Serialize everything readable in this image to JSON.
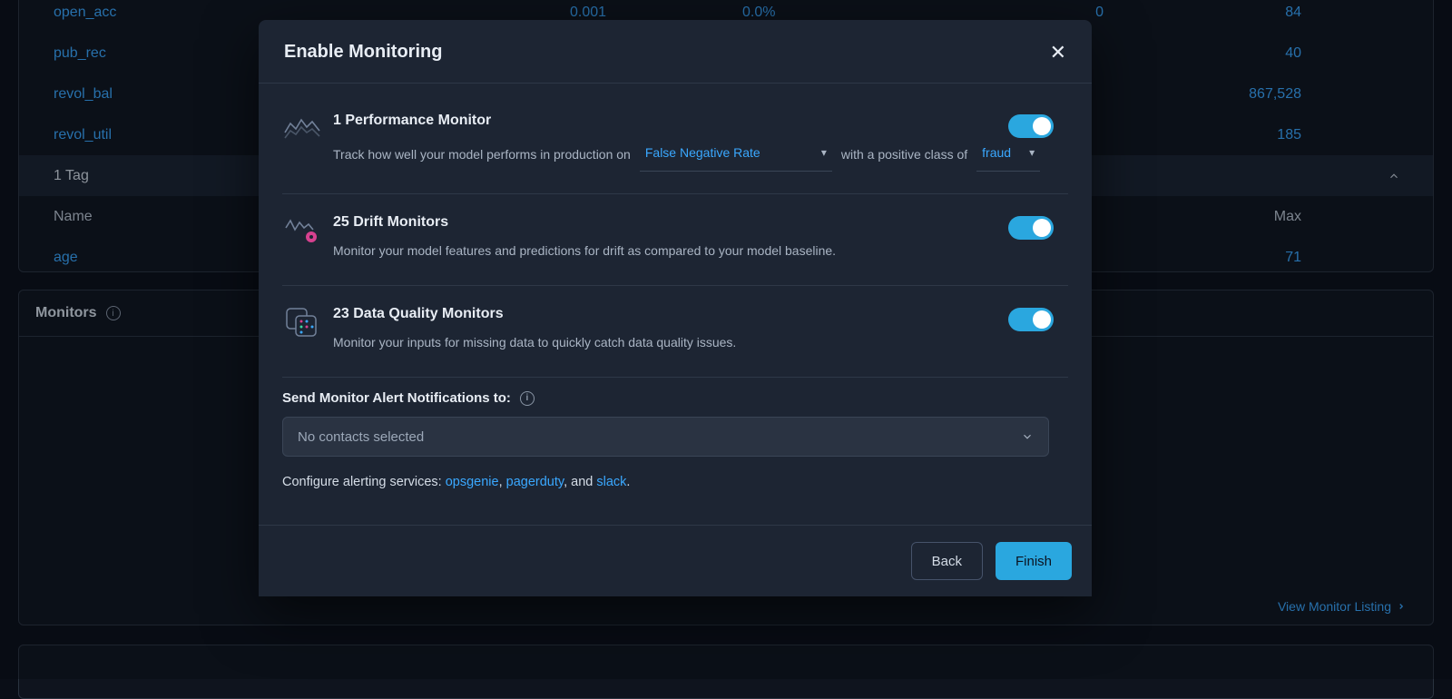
{
  "table": {
    "rows": [
      {
        "name": "open_acc",
        "c1": "0.001",
        "c2": "0.0%",
        "c3": "0",
        "max": "84"
      },
      {
        "name": "pub_rec",
        "c1": "",
        "c2": "",
        "c3": "",
        "max": "40"
      },
      {
        "name": "revol_bal",
        "c1": "",
        "c2": "",
        "c3": "",
        "max": "867,528"
      },
      {
        "name": "revol_util",
        "c1": "",
        "c2": "",
        "c3": "",
        "max": "185"
      }
    ],
    "tag_row": "1 Tag",
    "header": {
      "name": "Name",
      "max": "Max"
    },
    "data_rows2": [
      {
        "name": "age",
        "max": "71"
      }
    ]
  },
  "monitors_panel": {
    "title": "Monitors",
    "view_listing": "View Monitor Listing"
  },
  "modal": {
    "title": "Enable Monitoring",
    "sections": {
      "performance": {
        "title": "1 Performance Monitor",
        "desc_pre": "Track how well your model performs in production on",
        "metric_dd": "False Negative Rate",
        "desc_mid": "with a positive class of",
        "class_dd": "fraud"
      },
      "drift": {
        "title": "25 Drift Monitors",
        "desc": "Monitor your model features and predictions for drift as compared to your model baseline."
      },
      "quality": {
        "title": "23 Data Quality Monitors",
        "desc": "Monitor your inputs for missing data to quickly catch data quality issues."
      }
    },
    "alerts": {
      "label": "Send Monitor Alert Notifications to:",
      "placeholder": "No contacts selected",
      "configure_prefix": "Configure alerting services: ",
      "svc1": "opsgenie",
      "sep1": ", ",
      "svc2": "pagerduty",
      "sep2": ", and ",
      "svc3": "slack",
      "suffix": "."
    },
    "buttons": {
      "back": "Back",
      "finish": "Finish"
    }
  }
}
